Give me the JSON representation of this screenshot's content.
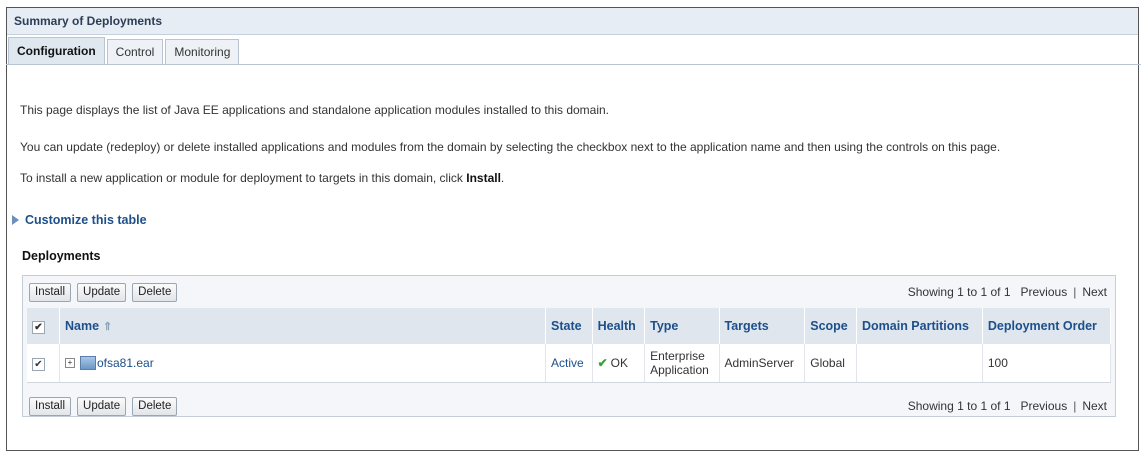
{
  "panel": {
    "title": "Summary of Deployments"
  },
  "tabs": [
    {
      "label": "Configuration",
      "active": true
    },
    {
      "label": "Control",
      "active": false
    },
    {
      "label": "Monitoring",
      "active": false
    }
  ],
  "intro": {
    "line1": "This page displays the list of Java EE applications and standalone application modules installed to this domain.",
    "line2": "You can update (redeploy) or delete installed applications and modules from the domain by selecting the checkbox next to the application name and then using the controls on this page.",
    "line3_prefix": "To install a new application or module for deployment to targets in this domain, click ",
    "line3_bold": "Install",
    "line3_suffix": "."
  },
  "customize": {
    "label": "Customize this table"
  },
  "deployments": {
    "title": "Deployments",
    "buttons": {
      "install": "Install",
      "update": "Update",
      "delete": "Delete"
    },
    "pager": {
      "showing": "Showing 1 to 1 of 1",
      "previous": "Previous",
      "next": "Next"
    },
    "columns": [
      "Name",
      "State",
      "Health",
      "Type",
      "Targets",
      "Scope",
      "Domain Partitions",
      "Deployment Order"
    ],
    "rows": [
      {
        "checked": true,
        "name": "ofsa81.ear",
        "state": "Active",
        "health": "OK",
        "type_line1": "Enterprise",
        "type_line2": "Application",
        "targets": "AdminServer",
        "scope": "Global",
        "domain_partitions": "",
        "deployment_order": "100"
      }
    ]
  },
  "colors": {
    "accent": "#1d4f8a",
    "header_bg": "#dfe6ee",
    "ok": "#3aa335"
  }
}
